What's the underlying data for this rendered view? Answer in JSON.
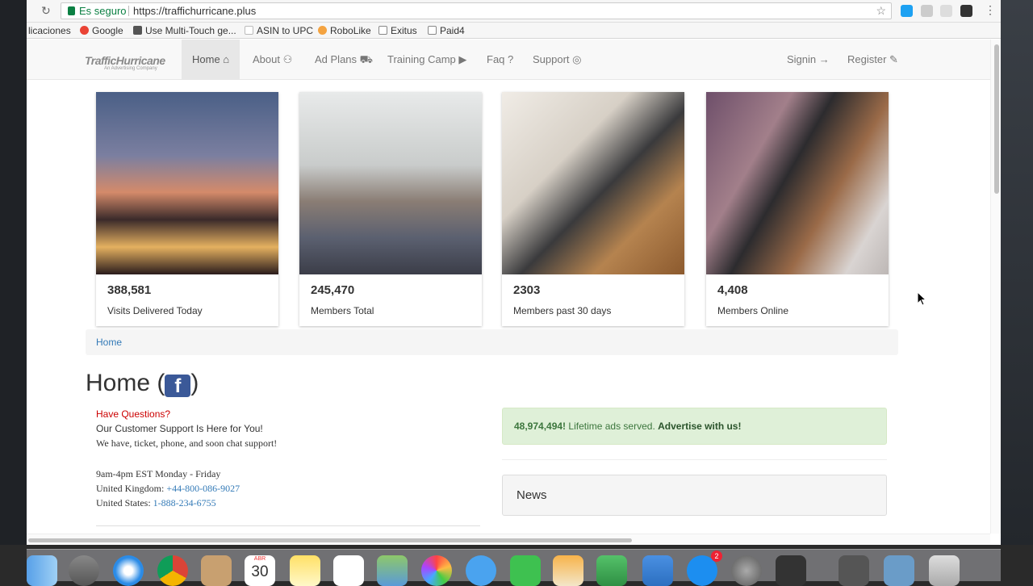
{
  "browser": {
    "secure_label": "Es seguro",
    "url": "https://traffichurricane.plus"
  },
  "bookmarks": [
    {
      "label": "licaciones",
      "icon": "apps-icon",
      "color": "#4285f4"
    },
    {
      "label": "Google",
      "icon": "google-icon",
      "color": "#ea4335"
    },
    {
      "label": "Use Multi-Touch ge...",
      "icon": "apple-icon",
      "color": "#555555"
    },
    {
      "label": "ASIN to UPC",
      "icon": "page-icon",
      "color": "#bbbbbb"
    },
    {
      "label": "RoboLike",
      "icon": "heart-icon",
      "color": "#f4a340"
    },
    {
      "label": "Exitus",
      "icon": "folder-icon",
      "color": "#888888"
    },
    {
      "label": "Paid4",
      "icon": "folder-icon",
      "color": "#888888"
    }
  ],
  "nav": {
    "logo": "TrafficHurricane",
    "logo_sub": "An Advertising Company",
    "items": [
      {
        "label": "Home ⌂",
        "active": true
      },
      {
        "label": "About ⚇"
      },
      {
        "label": "Ad Plans ⛟"
      },
      {
        "label": "Training Camp ▶"
      },
      {
        "label": "Faq ?"
      },
      {
        "label": "Support ◎"
      }
    ],
    "signin": "Signin →",
    "register": "Register ✎"
  },
  "stats": [
    {
      "value": "388,581",
      "label": "Visits Delivered Today"
    },
    {
      "value": "245,470",
      "label": "Members Total"
    },
    {
      "value": "2303",
      "label": "Members past 30 days"
    },
    {
      "value": "4,408",
      "label": "Members Online"
    }
  ],
  "breadcrumb": "Home",
  "page_title": "Home (",
  "page_title_end": ")",
  "fb_icon": "f",
  "support": {
    "questions": "Have Questions?",
    "line1": "Our Customer Support Is Here for You!",
    "line2": "We have, ticket, phone, and soon chat support!",
    "hours": "9am-4pm EST Monday - Friday",
    "uk_label": "United Kingdom: ",
    "uk_phone": "+44-800-086-9027",
    "us_label": "United States: ",
    "us_phone": "1-888-234-6755"
  },
  "alert": {
    "count": "48,974,494!",
    "text": " Lifetime ads served. ",
    "cta": "Advertise with us!"
  },
  "news_title": "News",
  "dock": {
    "calendar_day": "30",
    "calendar_month": "ABR",
    "badge": "2"
  }
}
